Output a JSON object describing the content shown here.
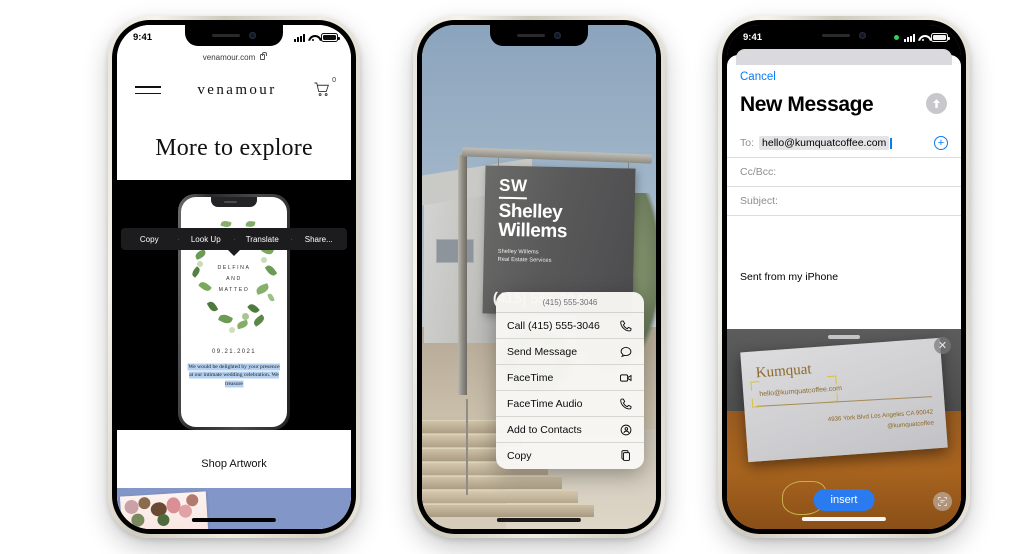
{
  "phones": [
    {
      "id": "phone-safari-venamour",
      "status_bar": {
        "time": "9:41",
        "cellular": "signal-bars-icon",
        "wifi": "wifi-icon",
        "battery": "battery-icon"
      },
      "browser": {
        "url": "venamour.com",
        "lock": "lock-icon"
      },
      "nav": {
        "menu": "hamburger-menu-icon",
        "brand": "venamour",
        "cart": "shopping-cart-icon",
        "cart_count": "0"
      },
      "heading": "More to explore",
      "invitation": {
        "name_line_1": "DELFINA",
        "name_line_2": "AND",
        "name_line_3": "MATTEO",
        "date": "09.21.2021",
        "paragraph": "We would be delighted by your presence at our intimate wedding celebration. We treasure"
      },
      "selection_menu": [
        "Copy",
        "Look Up",
        "Translate",
        "Share..."
      ],
      "shop_link": "Shop Artwork"
    },
    {
      "id": "phone-camera-live-text",
      "status_bar": {
        "time": "",
        "cellular": "signal-bars-icon",
        "wifi": "wifi-icon",
        "battery": "battery-icon"
      },
      "sign": {
        "initials": "SW",
        "name_line_1": "Shelley",
        "name_line_2": "Willems",
        "sub_line_1": "Shelley Willems",
        "sub_line_2": "Real Estate Services",
        "phone": "(415) 555-3046"
      },
      "context_menu": {
        "header": "(415) 555-3046",
        "items": [
          {
            "label": "Call (415) 555-3046",
            "icon": "phone-icon"
          },
          {
            "label": "Send Message",
            "icon": "message-bubble-icon"
          },
          {
            "label": "FaceTime",
            "icon": "video-camera-icon"
          },
          {
            "label": "FaceTime Audio",
            "icon": "phone-icon"
          },
          {
            "label": "Add to Contacts",
            "icon": "add-contact-icon"
          },
          {
            "label": "Copy",
            "icon": "copy-icon"
          }
        ]
      }
    },
    {
      "id": "phone-mail-compose",
      "status_bar": {
        "time": "9:41",
        "cellular": "signal-bars-icon",
        "wifi": "wifi-icon",
        "battery": "battery-icon",
        "recording_dot": "green-dot-icon"
      },
      "compose": {
        "cancel": "Cancel",
        "title": "New Message",
        "send": "send-arrow-icon",
        "to_label": "To:",
        "to_value": "hello@kumquatcoffee.com",
        "add_contact": "add-circle-icon",
        "cc_label": "Cc/Bcc:",
        "cc_value": "",
        "subject_label": "Subject:",
        "subject_value": "",
        "body": "Sent from my iPhone"
      },
      "scanner": {
        "close": "close-icon",
        "insert_button": "insert",
        "scan_button": "text-scan-icon",
        "business_card": {
          "brand": "Kumquat",
          "email": "hello@kumquatcoffee.com",
          "address": "4936 York Blvd Los Angeles CA 90042",
          "handle": "@kumquatcoffee"
        }
      }
    }
  ],
  "colors": {
    "ios_blue": "#0a7bf5",
    "insert_blue": "#2a7bf0",
    "selection_blue": "#b4d0f0",
    "page_background": "#8296c8",
    "menu_dark": "#1c1c1e"
  }
}
